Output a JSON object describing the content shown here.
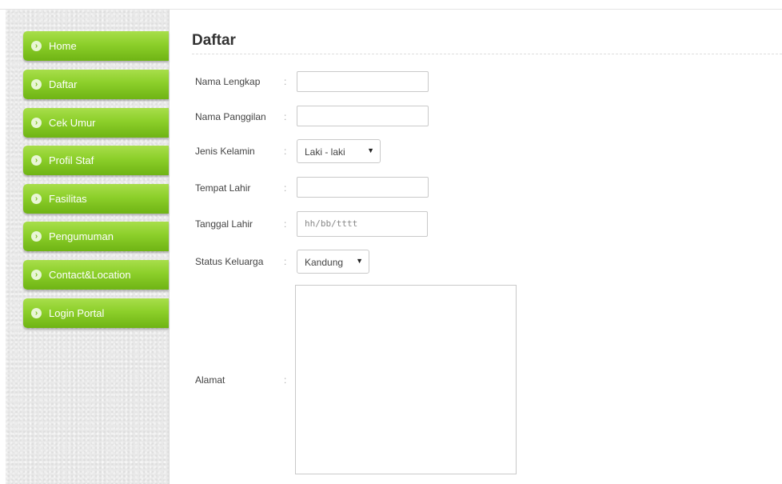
{
  "sidebar": {
    "items": [
      {
        "label": "Home"
      },
      {
        "label": "Daftar"
      },
      {
        "label": "Cek Umur"
      },
      {
        "label": "Profil Staf"
      },
      {
        "label": "Fasilitas"
      },
      {
        "label": "Pengumuman"
      },
      {
        "label": "Contact&Location"
      },
      {
        "label": "Login Portal"
      }
    ]
  },
  "main": {
    "title": "Daftar"
  },
  "form": {
    "separator": ":",
    "nama_lengkap": {
      "label": "Nama Lengkap",
      "value": ""
    },
    "nama_panggilan": {
      "label": "Nama Panggilan",
      "value": ""
    },
    "jenis_kelamin": {
      "label": "Jenis Kelamin",
      "selected": "Laki - laki"
    },
    "tempat_lahir": {
      "label": "Tempat Lahir",
      "value": ""
    },
    "tanggal_lahir": {
      "label": "Tanggal Lahir",
      "placeholder": "hh/bb/tttt"
    },
    "status_keluarga": {
      "label": "Status Keluarga",
      "selected": "Kandung"
    },
    "alamat": {
      "label": "Alamat",
      "value": ""
    }
  },
  "colors": {
    "accent": "#8ccf2a",
    "accent_dark": "#6fb414"
  },
  "icons": {
    "nav_bullet": "chevron-right-circle-icon",
    "select_arrow": "caret-down-icon"
  }
}
